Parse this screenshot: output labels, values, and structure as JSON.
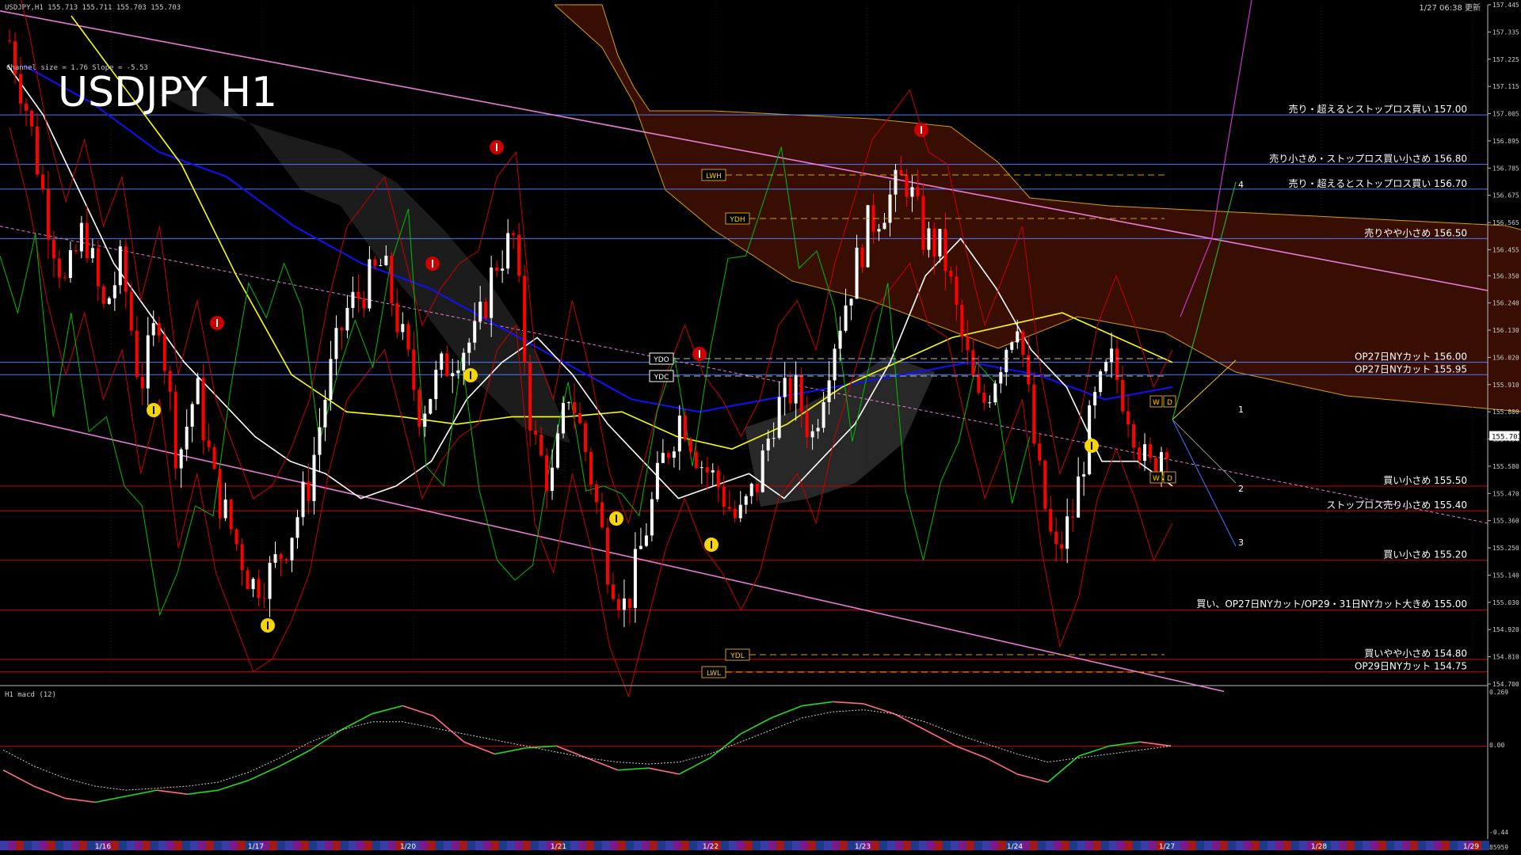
{
  "header": {
    "symbol_line": "USDJPY,H1  155.713 155.711 155.703 155.703",
    "channel_info": "Channel size = 1.76 Slope = -5.53",
    "big_title": "USDJPY H1",
    "updated": "1/27 06:38 更新"
  },
  "colors": {
    "bg": "#000000",
    "grid": "#1e1e1e",
    "up": "#ffffff",
    "down": "#ff0000",
    "ma_fast": "#ffffff",
    "ma_mid": "#ffff00",
    "ma_slow": "#1010ff",
    "boll": "#cc0000",
    "lag": "#00c000",
    "cloud_bear": "#a02808",
    "cloud_bull": "#c8c8c8",
    "trend": "#e87ad8",
    "blue_line": "#4a7cff",
    "red_line": "#d00000",
    "macd_up": "#22dd22",
    "macd_down": "#ff6a8a"
  },
  "chart_data": {
    "type": "line",
    "title": "USDJPY H1",
    "ylim": [
      154.7,
      157.445
    ],
    "y_ticks": [
      "157.445",
      "157.335",
      "157.225",
      "157.115",
      "157.005",
      "156.895",
      "156.785",
      "156.675",
      "156.565",
      "156.455",
      "156.350",
      "156.240",
      "156.130",
      "156.020",
      "155.910",
      "155.800",
      "155.690",
      "155.580",
      "155.470",
      "155.360",
      "155.250",
      "155.140",
      "155.030",
      "154.920",
      "154.810",
      "154.700"
    ],
    "x_labels": [
      "1/16",
      "1/17",
      "1/20",
      "1/21",
      "1/22",
      "1/23",
      "1/24",
      "1/27",
      "1/28",
      "1/29"
    ],
    "current_price": "155.703",
    "close_series": [
      157.3,
      157.0,
      156.6,
      156.3,
      156.55,
      156.2,
      156.4,
      155.9,
      156.2,
      155.6,
      155.9,
      155.5,
      155.3,
      155.1,
      155.15,
      155.3,
      155.5,
      155.9,
      156.2,
      156.3,
      156.4,
      156.1,
      155.8,
      155.95,
      156.05,
      156.1,
      156.4,
      156.5,
      155.7,
      155.5,
      155.9,
      155.6,
      155.2,
      155.0,
      155.3,
      155.6,
      155.8,
      155.6,
      155.5,
      155.35,
      155.5,
      155.8,
      155.9,
      155.7,
      156.05,
      156.3,
      156.55,
      156.65,
      156.75,
      156.5,
      156.45,
      156.1,
      155.8,
      156.0,
      156.2,
      155.6,
      155.2,
      155.4,
      155.8,
      156.0,
      155.8,
      155.55,
      155.7
    ],
    "ma_fast": [
      157.2,
      157.0,
      156.7,
      156.4,
      156.2,
      156.0,
      155.85,
      155.7,
      155.6,
      155.55,
      155.45,
      155.5,
      155.6,
      155.85,
      156.0,
      156.1,
      155.95,
      155.75,
      155.6,
      155.45,
      155.5,
      155.55,
      155.45,
      155.6,
      155.75,
      156.0,
      156.35,
      156.5,
      156.3,
      156.05,
      155.9,
      155.6,
      155.6,
      155.5
    ],
    "ma_mid": [
      157.4,
      157.1,
      156.8,
      156.35,
      155.95,
      155.8,
      155.78,
      155.75,
      155.78,
      155.78,
      155.8,
      155.7,
      155.65,
      155.75,
      155.9,
      156.0,
      156.1,
      156.15,
      156.2,
      156.1,
      156.0
    ],
    "ma_slow": [
      157.2,
      157.05,
      156.85,
      156.75,
      156.55,
      156.4,
      156.3,
      156.15,
      156.0,
      155.85,
      155.8,
      155.85,
      155.9,
      155.95,
      156.0,
      155.95,
      155.85,
      155.9
    ],
    "macd": [
      -0.12,
      -0.2,
      -0.26,
      -0.28,
      -0.25,
      -0.22,
      -0.24,
      -0.22,
      -0.17,
      -0.1,
      -0.02,
      0.08,
      0.16,
      0.2,
      0.15,
      0.02,
      -0.04,
      -0.01,
      0.0,
      -0.06,
      -0.12,
      -0.11,
      -0.14,
      -0.06,
      0.06,
      0.14,
      0.2,
      0.22,
      0.21,
      0.16,
      0.08,
      0.0,
      -0.06,
      -0.14,
      -0.18,
      -0.05,
      0.0,
      0.02,
      0.0
    ],
    "macd_signal": [
      -0.02,
      -0.1,
      -0.16,
      -0.2,
      -0.22,
      -0.21,
      -0.2,
      -0.18,
      -0.13,
      -0.06,
      0.02,
      0.08,
      0.12,
      0.12,
      0.09,
      0.06,
      0.03,
      0.0,
      -0.03,
      -0.06,
      -0.08,
      -0.09,
      -0.08,
      -0.04,
      0.02,
      0.08,
      0.14,
      0.17,
      0.18,
      0.16,
      0.12,
      0.06,
      0.01,
      -0.04,
      -0.08,
      -0.06,
      -0.04,
      -0.02,
      0.0
    ]
  },
  "levels": [
    {
      "label": "売り・超えるとストップロス買い 157.00",
      "price": 157.0,
      "color": "#4a7cff"
    },
    {
      "label": "売り小さめ・ストップロス買い小さめ 156.80",
      "price": 156.8,
      "color": "#4a7cff"
    },
    {
      "label": "売り・超えるとストップロス買い 156.70",
      "price": 156.7,
      "color": "#4a7cff"
    },
    {
      "label": "売りやや小さめ 156.50",
      "price": 156.5,
      "color": "#4a7cff"
    },
    {
      "label": "OP27日NYカット 156.00",
      "price": 156.0,
      "color": "#4a7cff"
    },
    {
      "label": "OP27日NYカット 155.95",
      "price": 155.95,
      "color": "#4a7cff"
    },
    {
      "label": "買い小さめ 155.50",
      "price": 155.5,
      "color": "#d00000"
    },
    {
      "label": "ストップロス売り小さめ 155.40",
      "price": 155.4,
      "color": "#d00000"
    },
    {
      "label": "買い小さめ 155.20",
      "price": 155.2,
      "color": "#d00000"
    },
    {
      "label": "買い、OP27日NYカット/OP29・31日NYカット大きめ 155.00",
      "price": 155.0,
      "color": "#d00000"
    },
    {
      "label": "買いやや小さめ 154.80",
      "price": 154.8,
      "color": "#d00000"
    },
    {
      "label": "OP29日NYカット 154.75",
      "price": 154.75,
      "color": "#d00000"
    }
  ],
  "boxes": [
    "LWH",
    "YDH",
    "YDO",
    "YDC",
    "YDL",
    "LWL"
  ],
  "wd_labels": [
    "W",
    "D"
  ],
  "channel_nums": [
    "1",
    "2",
    "3",
    "4"
  ],
  "macd_panel": {
    "title": "H1 macd (12)",
    "top": "0.269",
    "zero": "0.00",
    "bottom": "-0.44"
  },
  "footer_code": "85959"
}
